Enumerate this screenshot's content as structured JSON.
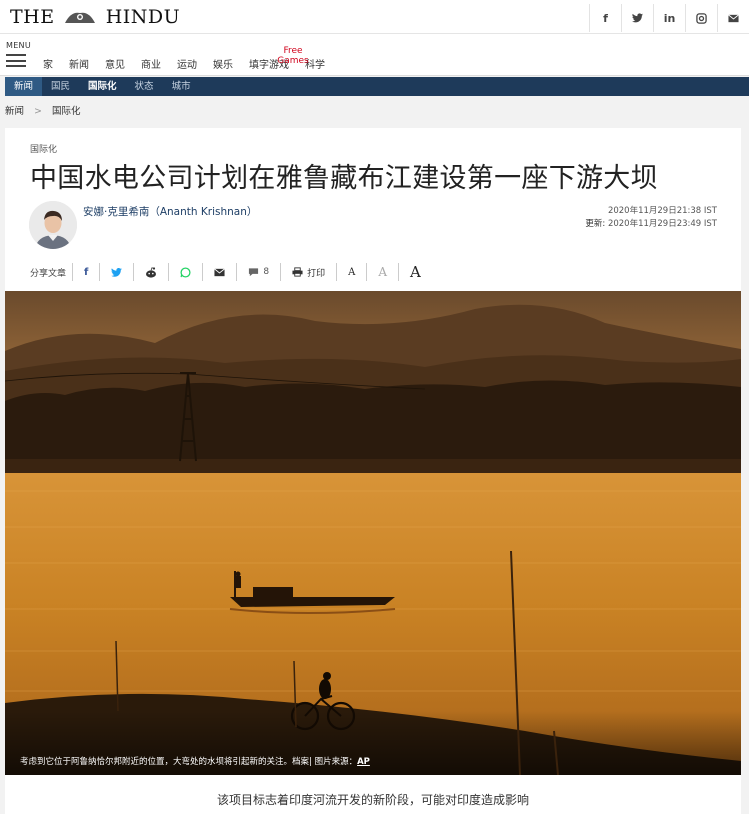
{
  "header": {
    "logo_left": "THE",
    "logo_right": "HINDU",
    "social": [
      {
        "icon": "facebook-icon",
        "glyph": "f"
      },
      {
        "icon": "twitter-icon",
        "glyph": "🐦"
      },
      {
        "icon": "linkedin-icon",
        "glyph": "in"
      },
      {
        "icon": "instagram-icon",
        "glyph": "◎"
      },
      {
        "icon": "mail-icon",
        "glyph": "✉"
      }
    ]
  },
  "nav": {
    "menu_label": "MENU",
    "links": [
      "家",
      "新闻",
      "意见",
      "商业",
      "运动",
      "娱乐",
      "填字游戏",
      "科学"
    ],
    "ad_label": "Free Games"
  },
  "sections": {
    "items": [
      "新闻",
      "国民",
      "国际化",
      "状态",
      "城市"
    ],
    "active_index": 2
  },
  "breadcrumb": {
    "home": "新闻",
    "separator": ">",
    "current": "国际化"
  },
  "article": {
    "kicker": "国际化",
    "headline": "中国水电公司计划在雅鲁藏布江建设第一座下游大坝",
    "author": "安娜·克里希南（Ananth Krishnan）",
    "published": "2020年11月29日21:38 IST",
    "updated_label": "更新:",
    "updated": "2020年11月29日23:49 IST",
    "share": {
      "label": "分享文章",
      "comments_count": "8",
      "print_label": "打印",
      "font_small": "A",
      "font_medium": "A",
      "font_large": "A"
    },
    "caption": "考虑到它位于阿鲁纳恰尔邦附近的位置，大弯处的水坝将引起新的关注。档案| 图片来源：",
    "caption_source": "AP",
    "standfirst": "该项目标志着印度河流开发的新阶段，可能对印度造成影响"
  },
  "colors": {
    "section_bar": "#1e3a5a",
    "section_first": "#2f5a84",
    "author_link": "#1f3f66",
    "ad_red": "#d0021b"
  }
}
